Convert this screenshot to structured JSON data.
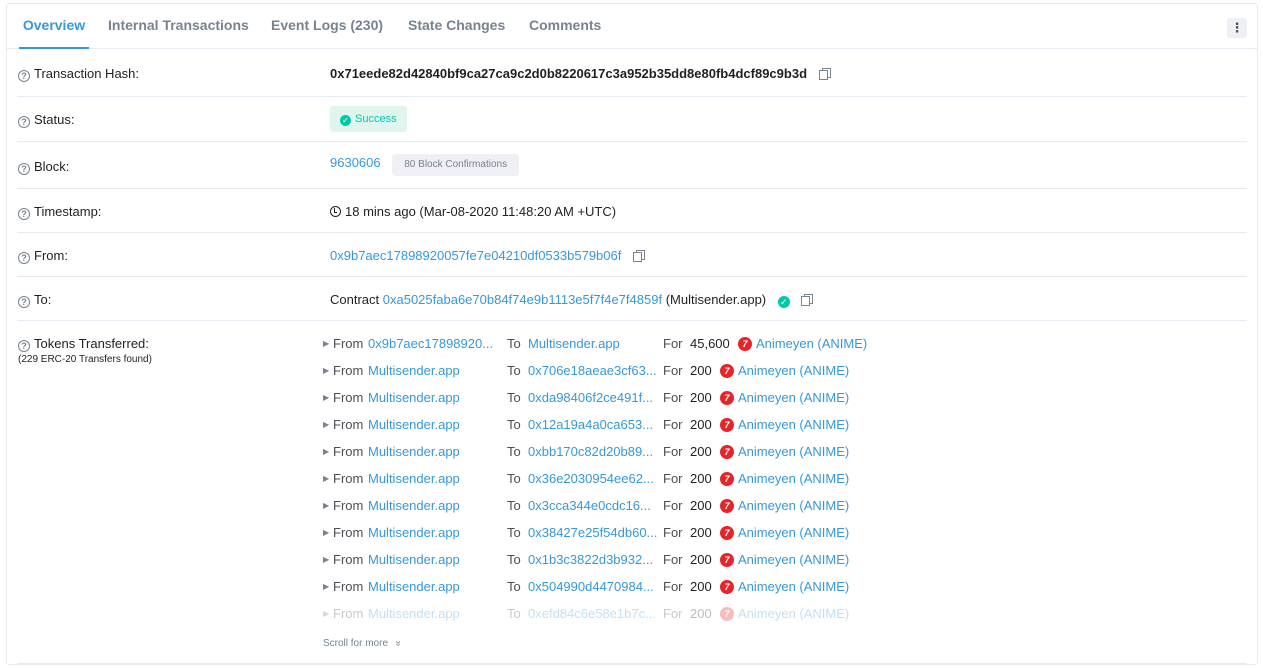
{
  "tabs": {
    "overview": "Overview",
    "internal": "Internal Transactions",
    "events": "Event Logs (230)",
    "state": "State Changes",
    "comments": "Comments"
  },
  "more_icon": "⋮",
  "rows": {
    "hash": {
      "label": "Transaction Hash:",
      "value": "0x71eede82d42840bf9ca27ca9c2d0b8220617c3a952b35dd8e80fb4dcf89c9b3d"
    },
    "status": {
      "label": "Status:",
      "value": "Success"
    },
    "block": {
      "label": "Block:",
      "value": "9630606",
      "confirmations": "80 Block Confirmations"
    },
    "timestamp": {
      "label": "Timestamp:",
      "value": "18 mins ago (Mar-08-2020 11:48:20 AM +UTC)"
    },
    "from": {
      "label": "From:",
      "value": "0x9b7aec17898920057fe7e04210df0533b579b06f"
    },
    "to": {
      "label": "To:",
      "prefix": "Contract",
      "value": "0xa5025faba6e70b84f74e9b1113e5f7f4e7f4859f",
      "name": "(Multisender.app)"
    },
    "tokens": {
      "label": "Tokens Transferred:",
      "sublabel": "(229 ERC-20 Transfers found)"
    }
  },
  "transfer_words": {
    "from": "From",
    "to": "To",
    "for": "For"
  },
  "transfers": [
    {
      "from": "0x9b7aec17898920...",
      "to": "Multisender.app",
      "amount": "45,600",
      "token": "Animeyen (ANIME)"
    },
    {
      "from": "Multisender.app",
      "to": "0x706e18aeae3cf63...",
      "amount": "200",
      "token": "Animeyen (ANIME)"
    },
    {
      "from": "Multisender.app",
      "to": "0xda98406f2ce491f...",
      "amount": "200",
      "token": "Animeyen (ANIME)"
    },
    {
      "from": "Multisender.app",
      "to": "0x12a19a4a0ca653...",
      "amount": "200",
      "token": "Animeyen (ANIME)"
    },
    {
      "from": "Multisender.app",
      "to": "0xbb170c82d20b89...",
      "amount": "200",
      "token": "Animeyen (ANIME)"
    },
    {
      "from": "Multisender.app",
      "to": "0x36e2030954ee62...",
      "amount": "200",
      "token": "Animeyen (ANIME)"
    },
    {
      "from": "Multisender.app",
      "to": "0x3cca344e0cdc16...",
      "amount": "200",
      "token": "Animeyen (ANIME)"
    },
    {
      "from": "Multisender.app",
      "to": "0x38427e25f54db60...",
      "amount": "200",
      "token": "Animeyen (ANIME)"
    },
    {
      "from": "Multisender.app",
      "to": "0x1b3c3822d3b932...",
      "amount": "200",
      "token": "Animeyen (ANIME)"
    },
    {
      "from": "Multisender.app",
      "to": "0x504990d4470984...",
      "amount": "200",
      "token": "Animeyen (ANIME)"
    },
    {
      "from": "Multisender.app",
      "to": "0xefd84c6e58e1b7c...",
      "amount": "200",
      "token": "Animeyen (ANIME)"
    }
  ],
  "scroll_more": "Scroll for more",
  "scroll_icon": "»",
  "question_icon": "?",
  "check_icon": "✓",
  "token_icon_letter": "7",
  "colors": {
    "link": "#3498db",
    "success": "#00c9a7",
    "token": "#e8242b"
  }
}
